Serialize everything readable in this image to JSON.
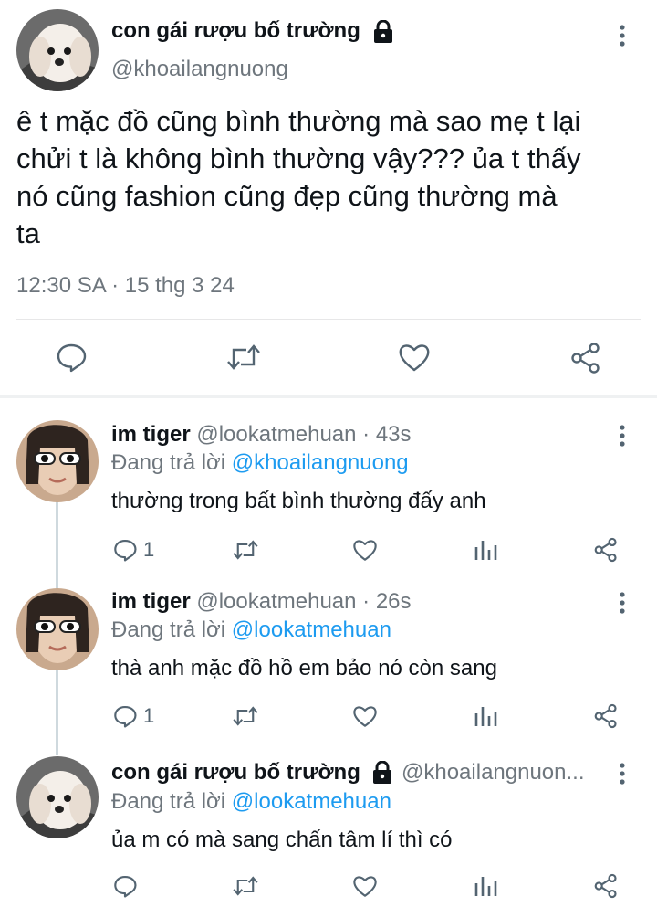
{
  "main_tweet": {
    "display_name": "con gái rượu bố trường",
    "handle": "@khoailangnuong",
    "text_lines": [
      "ê t mặc đồ cũng bình thường mà sao mẹ t lại",
      "chửi t là không bình thường vậy??? ủa t thấy",
      "nó cũng fashion cũng đẹp cũng thường mà",
      "ta"
    ],
    "timestamp": "12:30 SA · 15 thg 3 24"
  },
  "replies": [
    {
      "display_name": "im tiger",
      "handle_time": "@lookatmehuan · 43s",
      "replying_prefix": "Đang trả lời",
      "replying_to": "@khoailangnuong",
      "text": "thường trong bất bình thường đấy anh",
      "reply_count": "1"
    },
    {
      "display_name": "im tiger",
      "handle_time": "@lookatmehuan · 26s",
      "replying_prefix": "Đang trả lời",
      "replying_to": "@lookatmehuan",
      "text": "thà anh mặc đồ hồ em bảo nó còn sang",
      "reply_count": "1"
    },
    {
      "display_name": "con gái rượu bố trường",
      "handle_time": "@khoailangnuon...",
      "replying_prefix": "Đang trả lời",
      "replying_to": "@lookatmehuan",
      "text": "ủa m có mà sang chấn tâm lí thì có",
      "reply_count": ""
    }
  ],
  "colors": {
    "text": "#0f1419",
    "secondary": "#6e767d",
    "accent": "#1d9bf0",
    "divider": "#e7e7e8",
    "icon": "#536471"
  },
  "icons": [
    "lock-icon",
    "more-icon",
    "reply-icon",
    "retweet-icon",
    "like-icon",
    "share-icon",
    "views-icon"
  ]
}
